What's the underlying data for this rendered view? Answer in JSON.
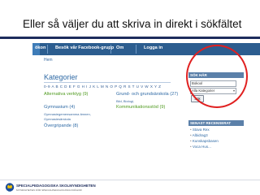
{
  "slide": {
    "title": "Eller så väljer du att skriva in direkt i sökfältet"
  },
  "nav": {
    "items": [
      "ökon",
      "Besök vår Facebook-grupp",
      "Om",
      "Logga in"
    ]
  },
  "page": {
    "home_link": "Hem",
    "heading": "Kategorier",
    "letters": "0-9  A  B  C  D  E  F  G  H  I  J  K  L  M  N  O  P  Q  R  S  T  U  V  W  X  Y  Z"
  },
  "categories": {
    "col1": [
      {
        "label": "Alternativa verktyg",
        "count": "(9)",
        "color": "green"
      },
      {
        "label": "Gymnasium",
        "count": "(4)",
        "color": "blue",
        "sub": [
          "Gymnasiegemensamma ämnen,",
          "Gymnasiesärskola"
        ]
      },
      {
        "label": "Övergripande",
        "count": "(8)",
        "color": "blue"
      }
    ],
    "col2": [
      {
        "label": "Grund- och grundsärskola",
        "count": "(27)",
        "color": "blue",
        "sub": [
          "Bild, Biologi,"
        ]
      },
      {
        "label": "Kommunikationsstöd",
        "count": "(9)",
        "color": "green"
      }
    ]
  },
  "sidebar": {
    "search_title": "SÖK HÄR",
    "search_value": "Bokool",
    "select_value": "Alla Kategorier",
    "search_button": "Sök",
    "recent_title": "SENAST RECENSERAT",
    "recent_items": [
      "Stava Rex",
      "Albidrag3",
      "Kunskapsbasen",
      "Voca Hus..."
    ]
  },
  "footer": {
    "org_name": "SPECIALPEDAGOGISKA SKOLMYNDIGHETEN",
    "org_sub": "MYNDIGHETEN FÖR SPECIALPEDAGOGISKA FRÅGOR"
  },
  "colors": {
    "nav_bg": "#2c5d8f",
    "link_blue": "#2f6aa5",
    "category_green": "#4f9a1f",
    "sidebar_header": "#5b80a9",
    "highlight_circle": "#e02020",
    "title_rule": "#1d2c5c"
  }
}
